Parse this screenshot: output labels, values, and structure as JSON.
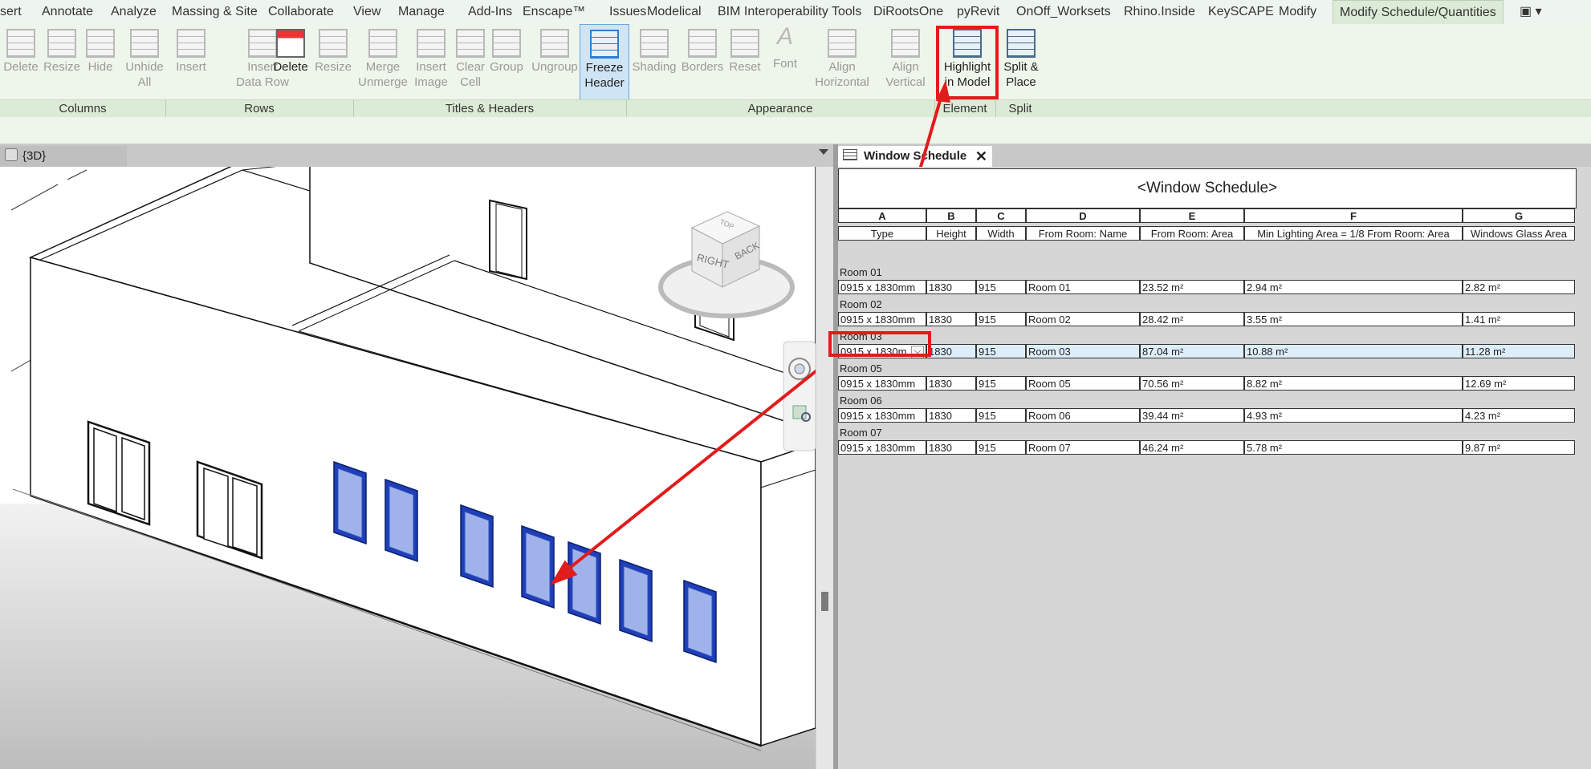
{
  "tabs": [
    "sert",
    "Annotate",
    "Analyze",
    "Massing & Site",
    "Collaborate",
    "View",
    "Manage",
    "Add-Ins",
    "Enscape™",
    "Issues",
    "Modelical",
    "BIM Interoperability Tools",
    "DiRootsOne",
    "pyRevit",
    "OnOff_Worksets",
    "Rhino.Inside",
    "KeySCAPE",
    "Modify",
    "Modify Schedule/Quantities"
  ],
  "ribbon": {
    "buttons": [
      {
        "label": "Delete"
      },
      {
        "label": "Resize"
      },
      {
        "label": "Hide"
      },
      {
        "label": "Unhide\nAll"
      },
      {
        "label": "Insert"
      },
      {
        "label": "Insert\nData Row"
      },
      {
        "label": "Delete"
      },
      {
        "label": "Resize"
      },
      {
        "label": "Merge\nUnmerge"
      },
      {
        "label": "Insert\nImage"
      },
      {
        "label": "Clear\nCell"
      },
      {
        "label": "Group"
      },
      {
        "label": "Ungroup"
      },
      {
        "label": "Freeze\nHeader"
      },
      {
        "label": "Shading"
      },
      {
        "label": "Borders"
      },
      {
        "label": "Reset"
      },
      {
        "label": "Font"
      },
      {
        "label": "Align\nHorizontal"
      },
      {
        "label": "Align\nVertical"
      },
      {
        "label": "Highlight\nin Model"
      },
      {
        "label": "Split &\nPlace"
      }
    ],
    "groups": [
      "Columns",
      "Rows",
      "Titles & Headers",
      "Appearance",
      "Element",
      "Split"
    ]
  },
  "views": {
    "left_tab": "{3D}",
    "right_tab": "Window Schedule"
  },
  "viewcube": {
    "right": "RIGHT",
    "back": "BACK",
    "top": "TOP"
  },
  "schedule": {
    "title": "<Window Schedule>",
    "letters": [
      "A",
      "B",
      "C",
      "D",
      "E",
      "F",
      "G"
    ],
    "headers": [
      "Type",
      "Height",
      "Width",
      "From Room: Name",
      "From Room: Area",
      "Min Lighting Area = 1/8 From Room: Area",
      "Windows Glass Area"
    ],
    "groups": [
      {
        "label": "Room 01",
        "row": [
          "0915 x 1830mm",
          "1830",
          "915",
          "Room 01",
          "23.52 m²",
          "2.94 m²",
          "2.82 m²"
        ]
      },
      {
        "label": "Room 02",
        "row": [
          "0915 x 1830mm",
          "1830",
          "915",
          "Room 02",
          "28.42 m²",
          "3.55 m²",
          "1.41 m²"
        ]
      },
      {
        "label": "Room 03",
        "row": [
          "0915 x 1830m",
          "1830",
          "915",
          "Room 03",
          "87.04 m²",
          "10.88 m²",
          "11.28 m²"
        ]
      },
      {
        "label": "Room 05",
        "row": [
          "0915 x 1830mm",
          "1830",
          "915",
          "Room 05",
          "70.56 m²",
          "8.82 m²",
          "12.69 m²"
        ]
      },
      {
        "label": "Room 06",
        "row": [
          "0915 x 1830mm",
          "1830",
          "915",
          "Room 06",
          "39.44 m²",
          "4.93 m²",
          "4.23 m²"
        ]
      },
      {
        "label": "Room 07",
        "row": [
          "0915 x 1830mm",
          "1830",
          "915",
          "Room 07",
          "46.24 m²",
          "5.78 m²",
          "9.87 m²"
        ]
      }
    ]
  },
  "colors": {
    "accent_red": "#e21b1b",
    "selected_window": "#2f5ee0",
    "ribbon_bg": "#eef5ea"
  }
}
